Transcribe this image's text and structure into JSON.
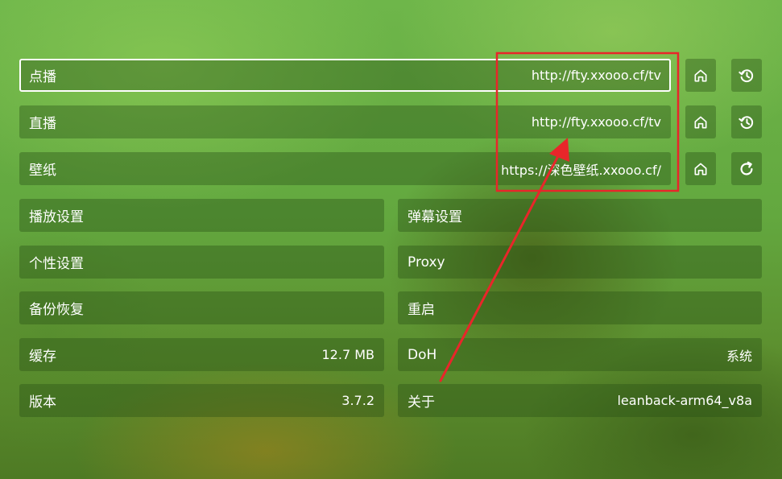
{
  "settings": {
    "vod": {
      "label": "点播",
      "url": "http://fty.xxooo.cf/tv"
    },
    "live": {
      "label": "直播",
      "url": "http://fty.xxooo.cf/tv"
    },
    "wallpaper": {
      "label": "壁纸",
      "url": "https://深色壁纸.xxooo.cf/"
    },
    "left": [
      {
        "label": "播放设置",
        "value": ""
      },
      {
        "label": "个性设置",
        "value": ""
      },
      {
        "label": "备份恢复",
        "value": ""
      },
      {
        "label": "缓存",
        "value": "12.7 MB"
      },
      {
        "label": "版本",
        "value": "3.7.2"
      }
    ],
    "right": [
      {
        "label": "弹幕设置",
        "value": ""
      },
      {
        "label": "Proxy",
        "value": ""
      },
      {
        "label": "重启",
        "value": ""
      },
      {
        "label": "DoH",
        "value": "系统"
      },
      {
        "label": "关于",
        "value": "leanback-arm64_v8a"
      }
    ]
  },
  "icons": {
    "home": "home-icon",
    "history": "history-icon",
    "refresh": "refresh-icon"
  },
  "colors": {
    "annotation": "#e8262a",
    "focus_border": "#ffffff"
  }
}
